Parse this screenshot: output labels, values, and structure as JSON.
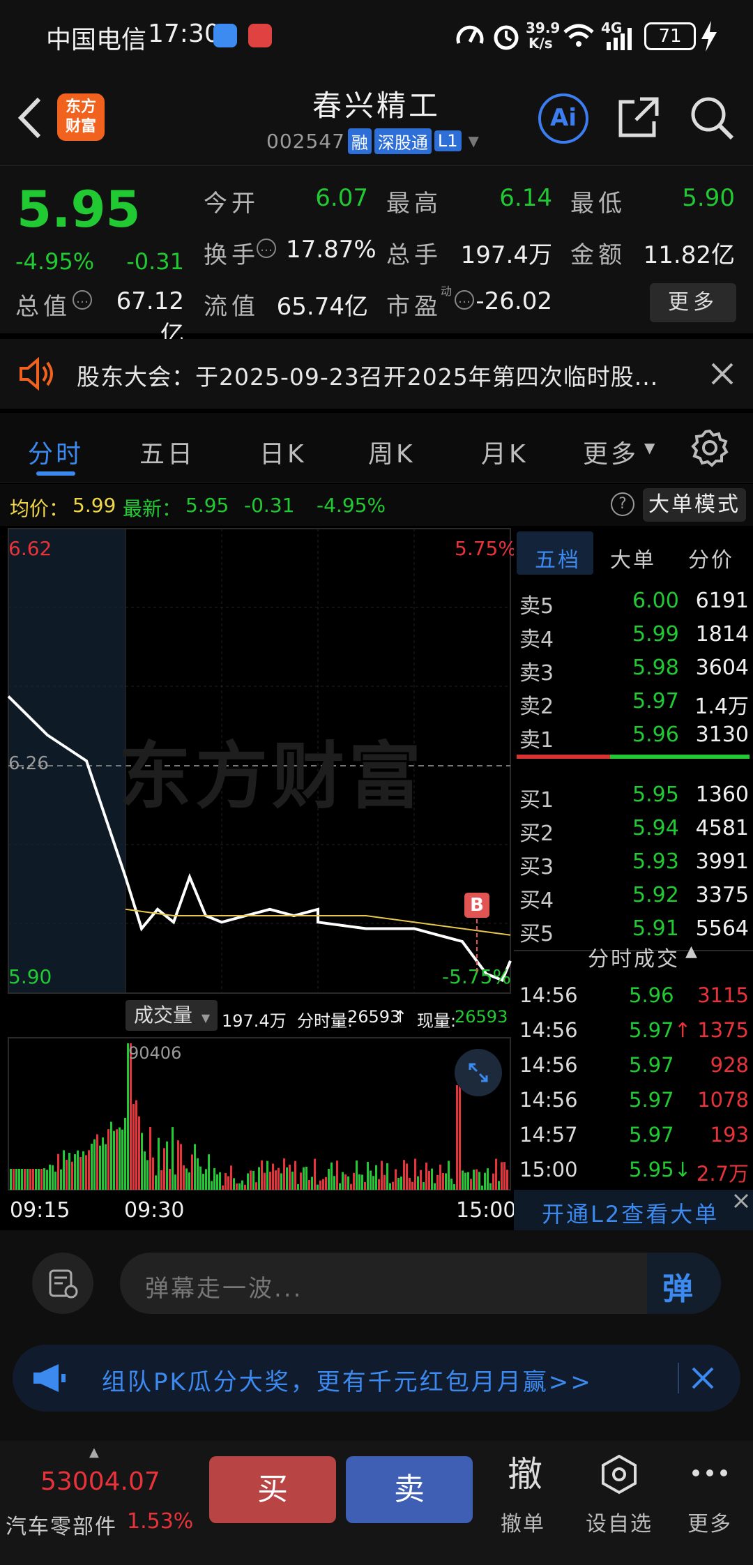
{
  "status": {
    "carrier": "中国电信",
    "time": "17:30",
    "speed_top": "39.9",
    "speed_bottom": "K/s",
    "network": "4G",
    "battery": "71"
  },
  "header": {
    "app_logo_text": "东方\n财富",
    "stock_name": "春兴精工",
    "stock_code": "002547",
    "badge_rong": "融",
    "badge_sgt": "深股通",
    "badge_level": "L1",
    "ai_label": "Ai"
  },
  "quote": {
    "price": "5.95",
    "change_pct": "-4.95%",
    "change": "-0.31",
    "open_label": "今开",
    "open": "6.07",
    "high_label": "最高",
    "high": "6.14",
    "low_label": "最低",
    "low": "5.90",
    "turnover_label": "换手",
    "turnover": "17.87%",
    "volume_label": "总手",
    "volume": "197.4万",
    "amount_label": "金额",
    "amount": "11.82亿",
    "mktcap_label": "总值",
    "mktcap": "67.12亿",
    "float_label": "流值",
    "float": "65.74亿",
    "pe_label": "市盈",
    "pe_sup": "动",
    "pe": "-26.02",
    "more_button": "更多"
  },
  "notice": {
    "text": "股东大会：于2025-09-23召开2025年第四次临时股..."
  },
  "tabs": [
    "分时",
    "五日",
    "日K",
    "周K",
    "月K",
    "更多"
  ],
  "infobar": {
    "avg_label": "均价：",
    "avg": "5.99",
    "last_label": "最新：",
    "last": "5.95",
    "chg": "-0.31",
    "chg_pct": "-4.95%",
    "mode_button": "大单模式"
  },
  "chart": {
    "price_top": "6.62",
    "pct_top": "5.75%",
    "price_mid": "6.26",
    "price_bottom": "5.90",
    "pct_bottom": "-5.75%",
    "watermark": "东方财富",
    "b_marker": "B",
    "vol_selector": "成交量",
    "vol_total": "197.4万",
    "vol_minute_label": "分时量:",
    "vol_minute": "26593",
    "vol_now_label": "现量:",
    "vol_now": "26593",
    "vol_max": "90406",
    "time_start": "09:15",
    "time_open": "09:30",
    "time_end": "15:00"
  },
  "chart_data": {
    "type": "line",
    "title": "",
    "ylim": [
      5.9,
      6.62
    ],
    "prev_close": 6.26,
    "series": [
      {
        "name": "最新",
        "x": [
          "09:15",
          "09:20",
          "09:25",
          "09:30",
          "09:40",
          "09:50",
          "10:00",
          "10:10",
          "10:20",
          "10:30",
          "10:45",
          "11:00",
          "11:15",
          "11:30",
          "13:00",
          "13:30",
          "14:00",
          "14:30",
          "14:45",
          "14:55",
          "15:00"
        ],
        "values": [
          6.36,
          6.3,
          6.26,
          6.08,
          6.0,
          6.03,
          6.01,
          6.08,
          6.02,
          6.01,
          6.02,
          6.03,
          6.02,
          6.03,
          6.01,
          6.0,
          6.0,
          5.98,
          5.93,
          5.92,
          5.95
        ]
      },
      {
        "name": "均价",
        "x": [
          "09:30",
          "10:00",
          "10:30",
          "11:00",
          "11:30",
          "13:00",
          "13:30",
          "14:00",
          "14:30",
          "15:00"
        ],
        "values": [
          6.03,
          6.02,
          6.02,
          6.02,
          6.02,
          6.02,
          6.02,
          6.01,
          6.0,
          5.99
        ]
      }
    ]
  },
  "orderbook": {
    "tabs": [
      "五档",
      "大单",
      "分价"
    ],
    "asks": [
      {
        "label": "卖5",
        "price": "6.00",
        "vol": "6191"
      },
      {
        "label": "卖4",
        "price": "5.99",
        "vol": "1814"
      },
      {
        "label": "卖3",
        "price": "5.98",
        "vol": "3604"
      },
      {
        "label": "卖2",
        "price": "5.97",
        "vol": "1.4万"
      },
      {
        "label": "卖1",
        "price": "5.96",
        "vol": "3130"
      }
    ],
    "bids": [
      {
        "label": "买1",
        "price": "5.95",
        "vol": "1360"
      },
      {
        "label": "买2",
        "price": "5.94",
        "vol": "4581"
      },
      {
        "label": "买3",
        "price": "5.93",
        "vol": "3991"
      },
      {
        "label": "买4",
        "price": "5.92",
        "vol": "3375"
      },
      {
        "label": "买5",
        "price": "5.91",
        "vol": "5564"
      }
    ],
    "trades_title": "分时成交",
    "trades": [
      {
        "time": "14:56",
        "price": "5.96",
        "arrow": "",
        "vol": "3115"
      },
      {
        "time": "14:56",
        "price": "5.97",
        "arrow": "↑",
        "vol": "1375"
      },
      {
        "time": "14:56",
        "price": "5.97",
        "arrow": "",
        "vol": "928"
      },
      {
        "time": "14:56",
        "price": "5.97",
        "arrow": "",
        "vol": "1078"
      },
      {
        "time": "14:57",
        "price": "5.97",
        "arrow": "",
        "vol": "193"
      },
      {
        "time": "15:00",
        "price": "5.95",
        "arrow": "↓",
        "vol": "2.7万"
      }
    ],
    "l2_link": "开通L2查看大单"
  },
  "danmu": {
    "placeholder": "弹幕走一波...",
    "send_label": "弹"
  },
  "promo": {
    "text": "组队PK瓜分大奖，更有千元红包月月赢>>"
  },
  "footer": {
    "index_value": "53004.07",
    "index_name": "汽车零部件",
    "index_change": "1.53%",
    "buy": "买",
    "sell": "卖",
    "withdraw_big": "撤",
    "withdraw": "撤单",
    "watch": "设自选",
    "more": "更多"
  }
}
